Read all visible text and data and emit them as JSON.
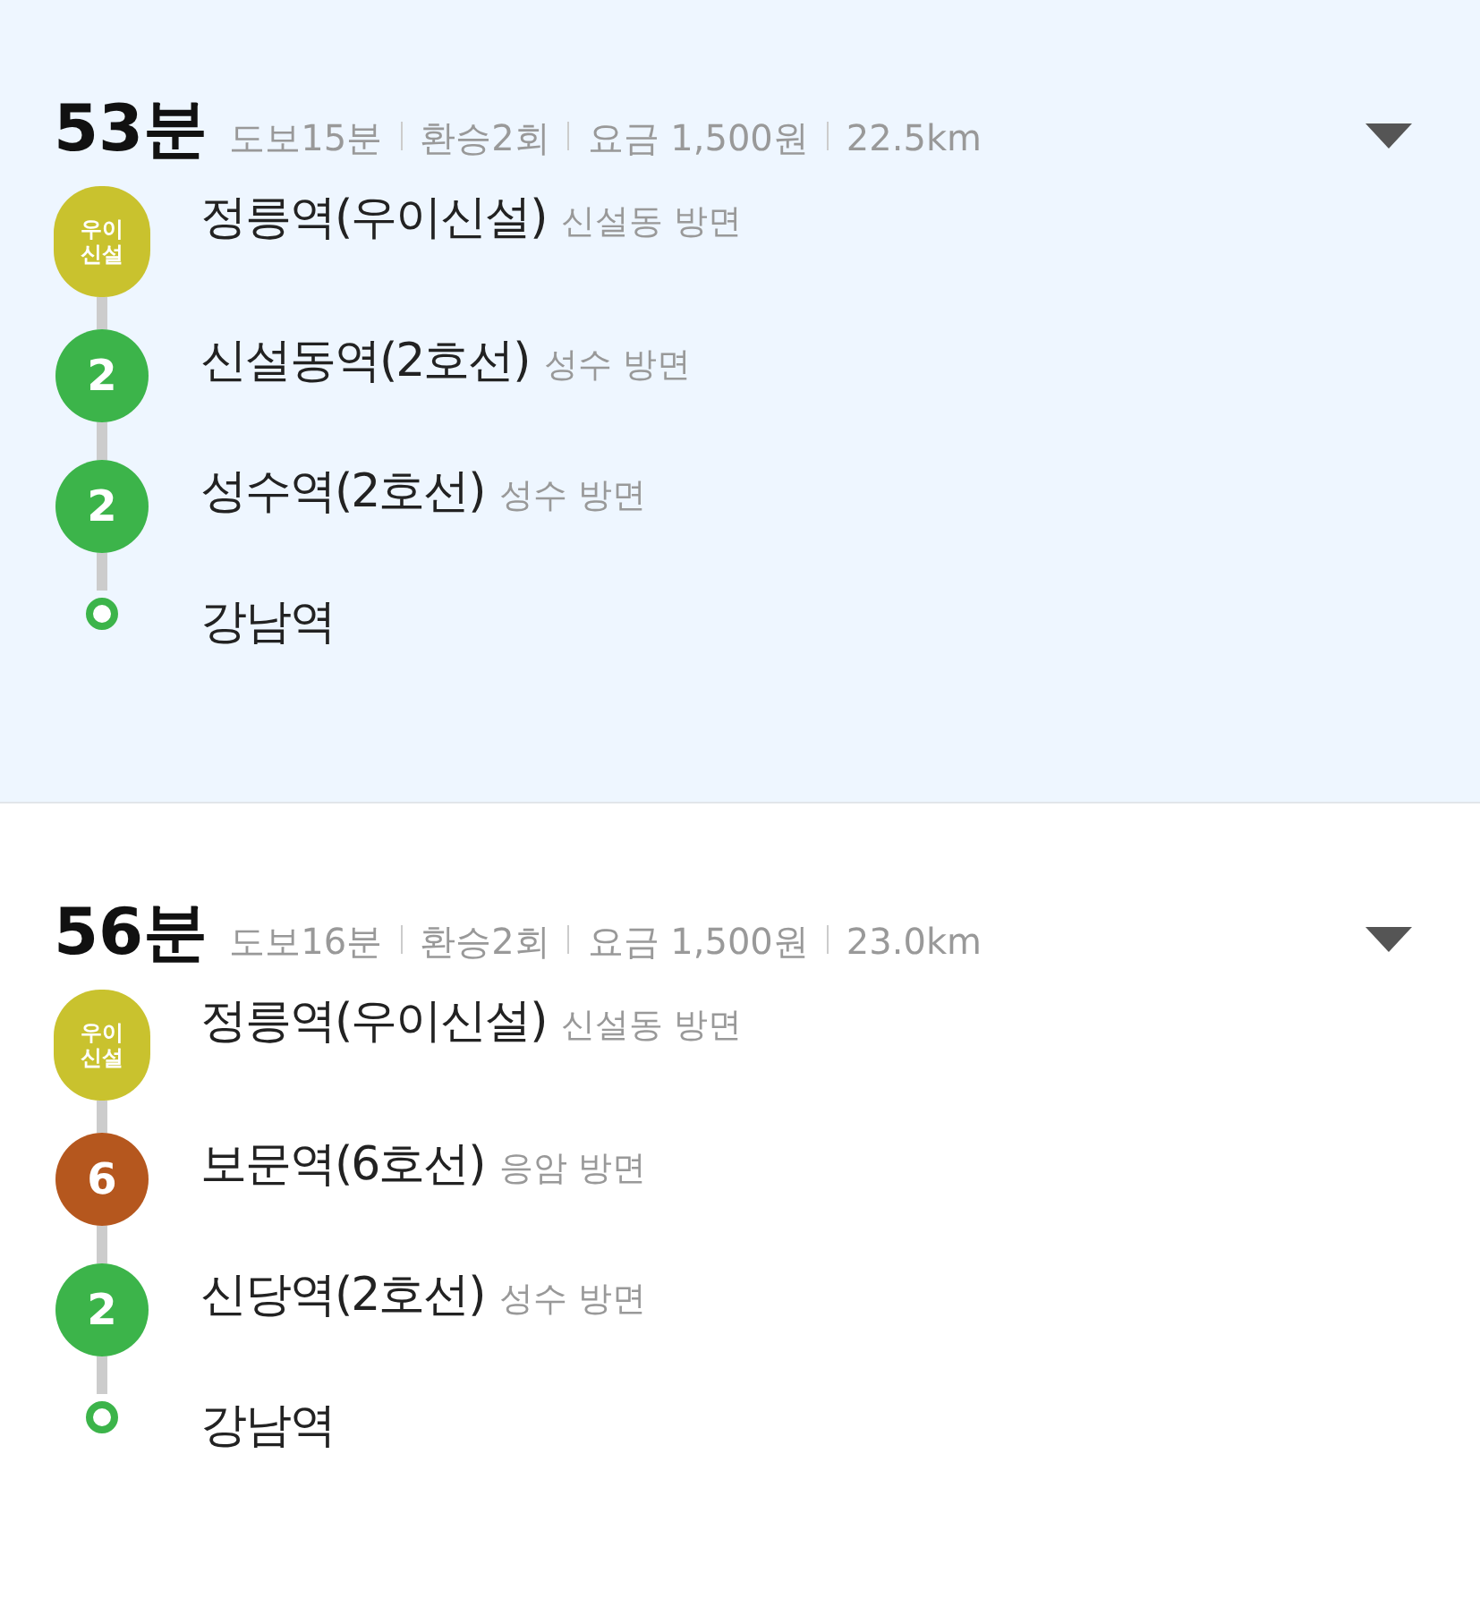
{
  "routes": [
    {
      "selected": true,
      "duration": "53분",
      "meta": [
        "도보15분",
        "환승2회",
        "요금 1,500원",
        "22.5km"
      ],
      "stops": [
        {
          "kind": "line",
          "badge": "우이신설",
          "color": "#c9c22e",
          "name": "정릉역(우이신설)",
          "direction": "신설동 방면"
        },
        {
          "kind": "line",
          "badge": "2",
          "color": "#3cb44a",
          "name": "신설동역(2호선)",
          "direction": "성수 방면"
        },
        {
          "kind": "line",
          "badge": "2",
          "color": "#3cb44a",
          "name": "성수역(2호선)",
          "direction": "성수 방면"
        },
        {
          "kind": "end",
          "color": "#3cb44a",
          "name": "강남역"
        }
      ]
    },
    {
      "selected": false,
      "duration": "56분",
      "meta": [
        "도보16분",
        "환승2회",
        "요금 1,500원",
        "23.0km"
      ],
      "stops": [
        {
          "kind": "line",
          "badge": "우이신설",
          "color": "#c9c22e",
          "name": "정릉역(우이신설)",
          "direction": "신설동 방면"
        },
        {
          "kind": "line",
          "badge": "6",
          "color": "#b5571e",
          "name": "보문역(6호선)",
          "direction": "응암 방면"
        },
        {
          "kind": "line",
          "badge": "2",
          "color": "#3cb44a",
          "name": "신당역(2호선)",
          "direction": "성수 방면"
        },
        {
          "kind": "end",
          "color": "#3cb44a",
          "name": "강남역"
        }
      ]
    }
  ]
}
